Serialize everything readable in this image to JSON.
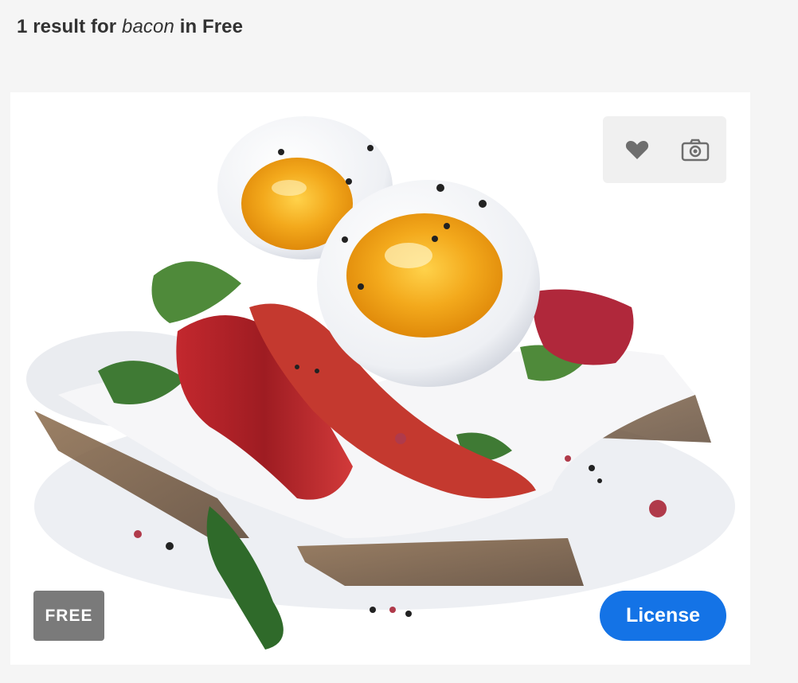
{
  "results": {
    "count_text": "1 result for",
    "query": "bacon",
    "scope_text": "in Free"
  },
  "card": {
    "image_alt": "Watercolor illustration of boiled eggs, bacon and greens on toast",
    "badge": "FREE",
    "license_label": "License",
    "actions": {
      "like_icon": "heart-icon",
      "find_similar_icon": "camera-icon"
    },
    "colors": {
      "license_bg": "#1473e6",
      "badge_bg": "#7a7a7a",
      "action_panel_bg": "#f0f0f0"
    }
  }
}
